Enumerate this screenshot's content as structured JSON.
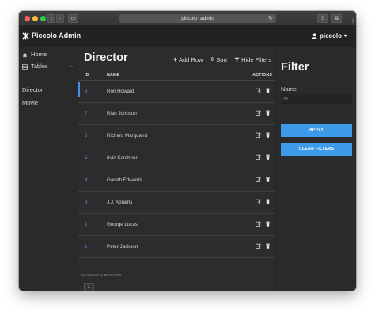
{
  "browser": {
    "url": "piccolo_admin",
    "new_tab_icon": "plus-icon"
  },
  "app": {
    "brand": "Piccolo Admin",
    "user": "piccolo"
  },
  "sidebar": {
    "items": [
      {
        "label": "Home",
        "icon": "home-icon"
      },
      {
        "label": "Tables",
        "icon": "table-icon"
      },
      {
        "label": "Director"
      },
      {
        "label": "Movie"
      }
    ]
  },
  "main": {
    "title": "Director",
    "toolbar": {
      "add_row": "Add Row",
      "sort": "Sort",
      "hide_filters": "Hide Filters"
    },
    "columns": {
      "id": "ID",
      "name": "NAME",
      "actions": "ACTIONS"
    },
    "rows": [
      {
        "id": "8",
        "name": "Ron Howard"
      },
      {
        "id": "7",
        "name": "Rian Johnson"
      },
      {
        "id": "6",
        "name": "Richard Marquand"
      },
      {
        "id": "5",
        "name": "Irvin Kershner"
      },
      {
        "id": "4",
        "name": "Gareth Edwards"
      },
      {
        "id": "3",
        "name": "J.J. Abrams"
      },
      {
        "id": "2",
        "name": "George Lucas"
      },
      {
        "id": "1",
        "name": "Peter Jackson"
      }
    ],
    "showing": "SHOWING 8 RESULTS",
    "page": "1"
  },
  "filter": {
    "title": "Filter",
    "name_label": "Name",
    "name_placeholder": "All",
    "apply": "APPLY",
    "clear": "CLEAR FILTERS"
  },
  "colors": {
    "accent": "#4a90e2",
    "button": "#3d9be9",
    "background": "#2c2c2c",
    "topbar": "#222222"
  }
}
